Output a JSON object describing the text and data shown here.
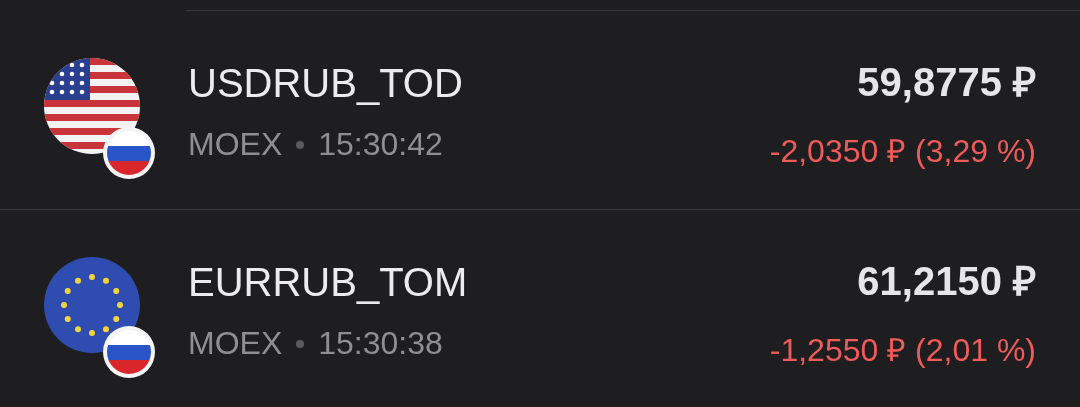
{
  "rows": [
    {
      "kind": "usd",
      "ticker": "USDRUB_TOD",
      "exchange": "MOEX",
      "time": "15:30:42",
      "price": "59,8775 ₽",
      "change": "-2,0350 ₽ (3,29 %)",
      "negative": true
    },
    {
      "kind": "eur",
      "ticker": "EURRUB_TOM",
      "exchange": "MOEX",
      "time": "15:30:38",
      "price": "61,2150 ₽",
      "change": "-1,2550 ₽ (2,01 %)",
      "negative": true
    }
  ]
}
